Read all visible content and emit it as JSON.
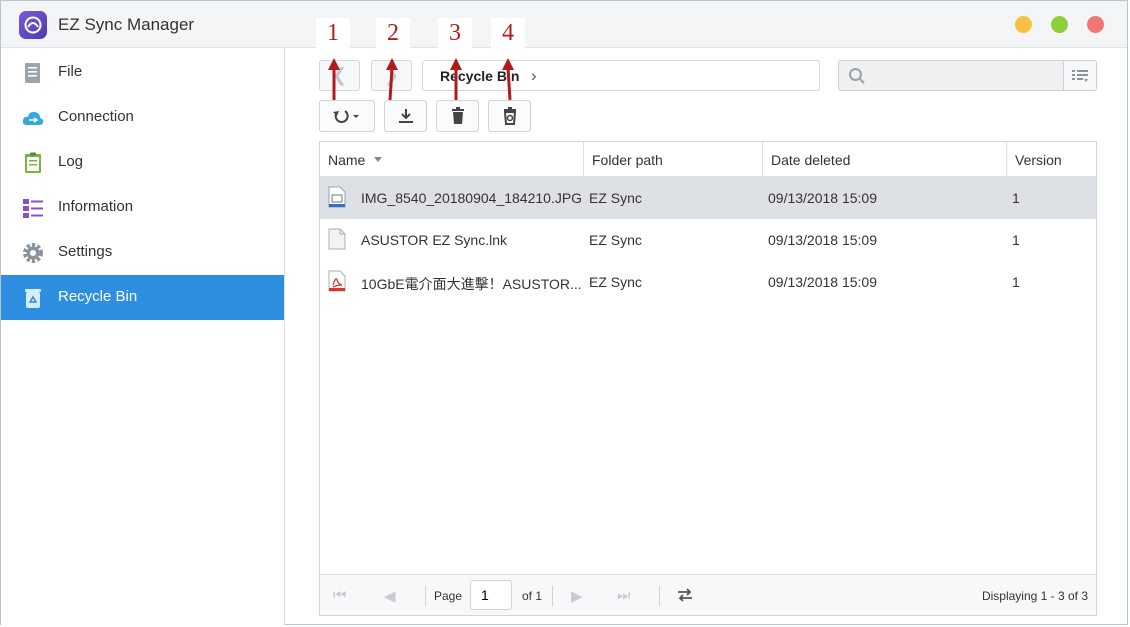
{
  "app": {
    "title": "EZ Sync Manager"
  },
  "window_controls": [
    "minimize",
    "maximize",
    "close"
  ],
  "sidebar": {
    "items": [
      {
        "label": "File",
        "icon": "file-icon",
        "active": false
      },
      {
        "label": "Connection",
        "icon": "cloud-icon",
        "active": false
      },
      {
        "label": "Log",
        "icon": "log-icon",
        "active": false
      },
      {
        "label": "Information",
        "icon": "list-icon",
        "active": false
      },
      {
        "label": "Settings",
        "icon": "gear-icon",
        "active": false
      },
      {
        "label": "Recycle Bin",
        "icon": "recycle-bin-icon",
        "active": true
      }
    ]
  },
  "breadcrumb": {
    "current": "Recycle Bin"
  },
  "search": {
    "placeholder": "",
    "value": ""
  },
  "toolbar": {
    "buttons": [
      "restore-icon",
      "download-icon",
      "delete-icon",
      "empty-recycle-bin-icon"
    ]
  },
  "annotations": [
    "1",
    "2",
    "3",
    "4"
  ],
  "table": {
    "columns": [
      "Name",
      "Folder path",
      "Date deleted",
      "Version"
    ],
    "sort": {
      "column": "Name",
      "direction": "desc"
    },
    "rows": [
      {
        "name": "IMG_8540_20180904_184210.JPG",
        "folder": "EZ Sync",
        "date": "09/13/2018 15:09",
        "version": "1",
        "icon": "image-file-icon",
        "selected": true
      },
      {
        "name": "ASUSTOR EZ Sync.lnk",
        "folder": "EZ Sync",
        "date": "09/13/2018 15:09",
        "version": "1",
        "icon": "generic-file-icon",
        "selected": false
      },
      {
        "name": "10GbE電介面大進擊！ASUSTOR...",
        "folder": "EZ Sync",
        "date": "09/13/2018 15:09",
        "version": "1",
        "icon": "pdf-file-icon",
        "selected": false
      }
    ]
  },
  "paging": {
    "page_label": "Page",
    "page_value": "1",
    "of_label": "of 1",
    "display": "Displaying 1 - 3 of 3"
  },
  "colors": {
    "accent": "#2e8fe0",
    "annotation": "#b01c1c",
    "selected_row": "#dde1e5"
  }
}
